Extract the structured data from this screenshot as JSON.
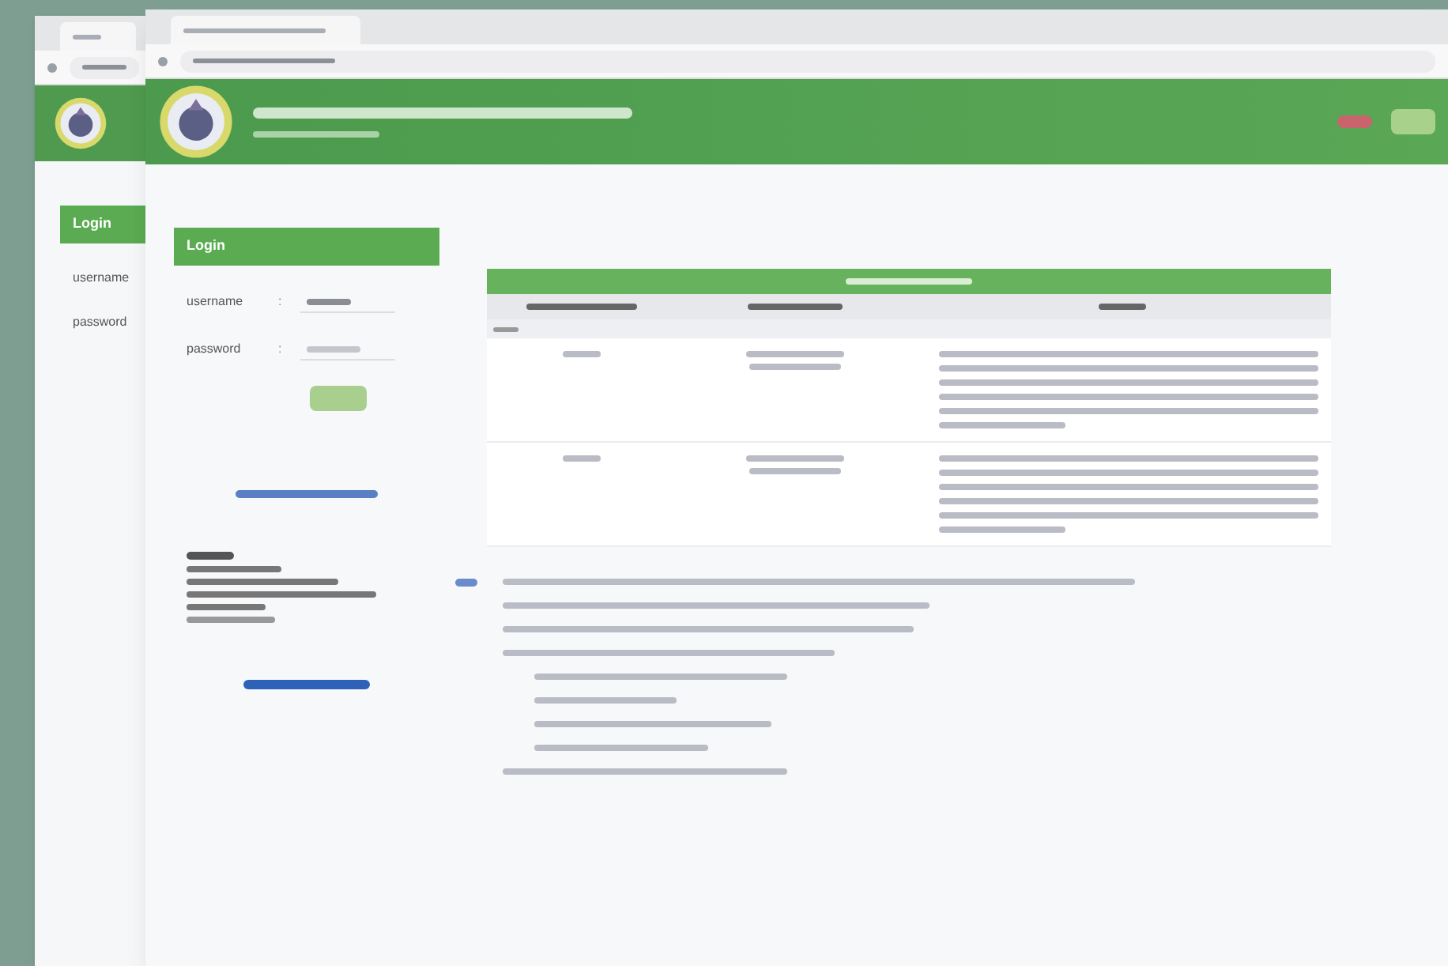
{
  "back_window": {
    "login": {
      "title": "Login",
      "fields": [
        {
          "label": "username"
        },
        {
          "label": "password"
        }
      ]
    }
  },
  "front_window": {
    "login": {
      "title": "Login",
      "fields": [
        {
          "label": "username",
          "separator": ":"
        },
        {
          "label": "password",
          "separator": ":"
        }
      ]
    }
  }
}
